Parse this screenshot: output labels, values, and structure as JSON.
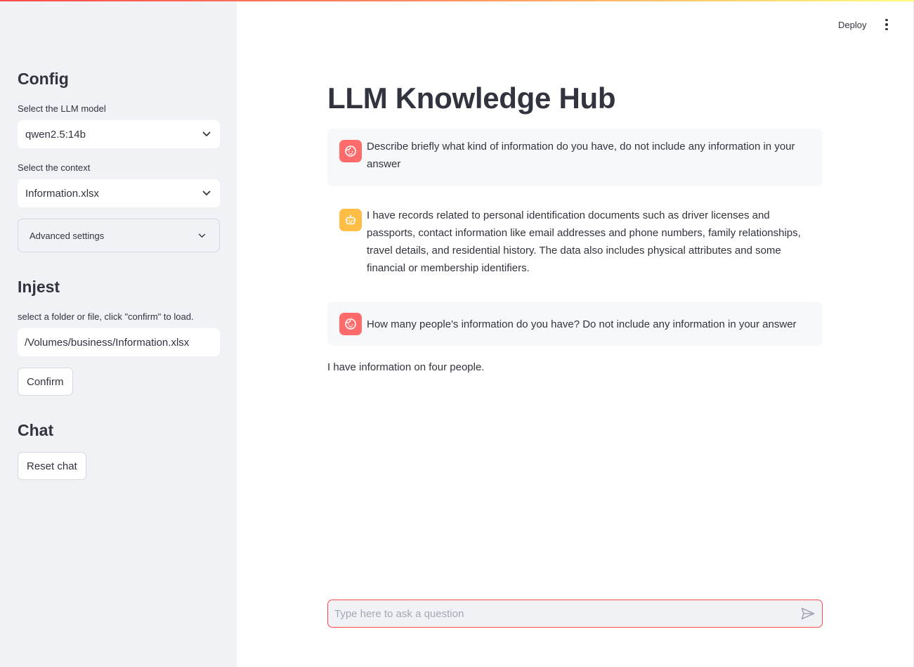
{
  "header": {
    "deploy_label": "Deploy",
    "menu_icon": "kebab-menu-icon"
  },
  "sidebar": {
    "config_heading": "Config",
    "model_label": "Select the LLM model",
    "model_value": "qwen2.5:14b",
    "context_label": "Select the context",
    "context_value": "Information.xlsx",
    "advanced_label": "Advanced settings",
    "injest_heading": "Injest",
    "injest_label": "select a folder or file, click \"confirm\" to load.",
    "path_value": "/Volumes/business/Information.xlsx",
    "confirm_label": "Confirm",
    "chat_heading": "Chat",
    "reset_label": "Reset chat"
  },
  "main": {
    "title": "LLM Knowledge Hub",
    "messages": [
      {
        "role": "user",
        "text": "Describe briefly what kind of information do you have, do not include any information in your answer"
      },
      {
        "role": "assistant",
        "text": "I have records related to personal identification documents such as driver licenses and passports, contact information like email addresses and phone numbers, family relationships, travel details, and residential history. The data also includes physical attributes and some financial or membership identifiers."
      },
      {
        "role": "user",
        "text": "How many people's information do you have? Do not include any information in your answer"
      },
      {
        "role": "assistant",
        "text": "I have information on four people."
      }
    ],
    "input_placeholder": "Type here to ask a question"
  },
  "colors": {
    "accent": "#ff4b4b",
    "sidebar_bg": "#f0f2f6",
    "user_avatar": "#ff6b6b",
    "bot_avatar": "#ffbd45",
    "text": "#31333f"
  }
}
